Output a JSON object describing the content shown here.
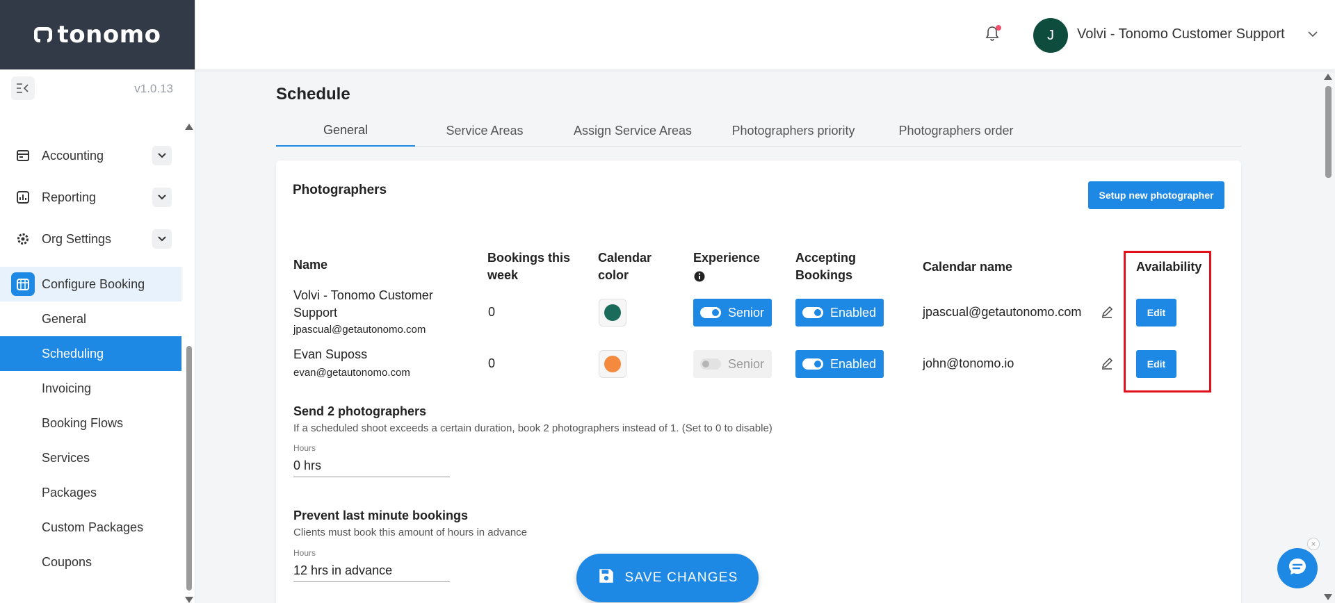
{
  "brand": {
    "logo_text": "tonomo",
    "version": "v1.0.13"
  },
  "header": {
    "avatar_initial": "J",
    "user_name": "Volvi - Tonomo Customer Support"
  },
  "sidebar": {
    "items": [
      {
        "label": "Accounting",
        "icon": "accounting-icon"
      },
      {
        "label": "Reporting",
        "icon": "reporting-icon"
      },
      {
        "label": "Org Settings",
        "icon": "gear-icon"
      },
      {
        "label": "Configure Booking",
        "icon": "calendar-icon"
      }
    ],
    "subitems": [
      "General",
      "Scheduling",
      "Invoicing",
      "Booking Flows",
      "Services",
      "Packages",
      "Custom Packages",
      "Coupons"
    ],
    "active_subitem": "Scheduling"
  },
  "page": {
    "title": "Schedule",
    "tabs": [
      "General",
      "Service Areas",
      "Assign Service Areas",
      "Photographers priority",
      "Photographers order"
    ],
    "active_tab": "General"
  },
  "photographers": {
    "title": "Photographers",
    "setup_button": "Setup new photographer",
    "columns": {
      "name": "Name",
      "bookings": "Bookings this week",
      "calendar_color": "Calendar color",
      "experience": "Experience",
      "accepting": "Accepting Bookings",
      "calendar_name": "Calendar name",
      "availability": "Availability"
    },
    "rows": [
      {
        "name": "Volvi - Tonomo Customer Support",
        "email": "jpascual@getautonomo.com",
        "bookings": "0",
        "color": "#1a6b5a",
        "experience": "Senior",
        "experience_on": true,
        "accepting": "Enabled",
        "calendar_name": "jpascual@getautonomo.com",
        "availability_button": "Edit"
      },
      {
        "name": "Evan Suposs",
        "email": "evan@getautonomo.com",
        "bookings": "0",
        "color": "#f5893d",
        "experience": "Senior",
        "experience_on": false,
        "accepting": "Enabled",
        "calendar_name": "john@tonomo.io",
        "availability_button": "Edit"
      }
    ]
  },
  "send_two": {
    "title": "Send 2 photographers",
    "description": "If a scheduled shoot exceeds a certain duration, book 2 photographers instead of 1. (Set to 0 to disable)",
    "field_label": "Hours",
    "value": "0 hrs"
  },
  "prevent_last_minute": {
    "title": "Prevent last minute bookings",
    "description": "Clients must book this amount of hours in advance",
    "field_label": "Hours",
    "value": "12 hrs in advance"
  },
  "save_button": "SAVE CHANGES",
  "colors": {
    "primary": "#1e88e5",
    "sidebar_dark": "#323a47",
    "highlight": "#e3111b",
    "avatar": "#0e4d3d"
  }
}
